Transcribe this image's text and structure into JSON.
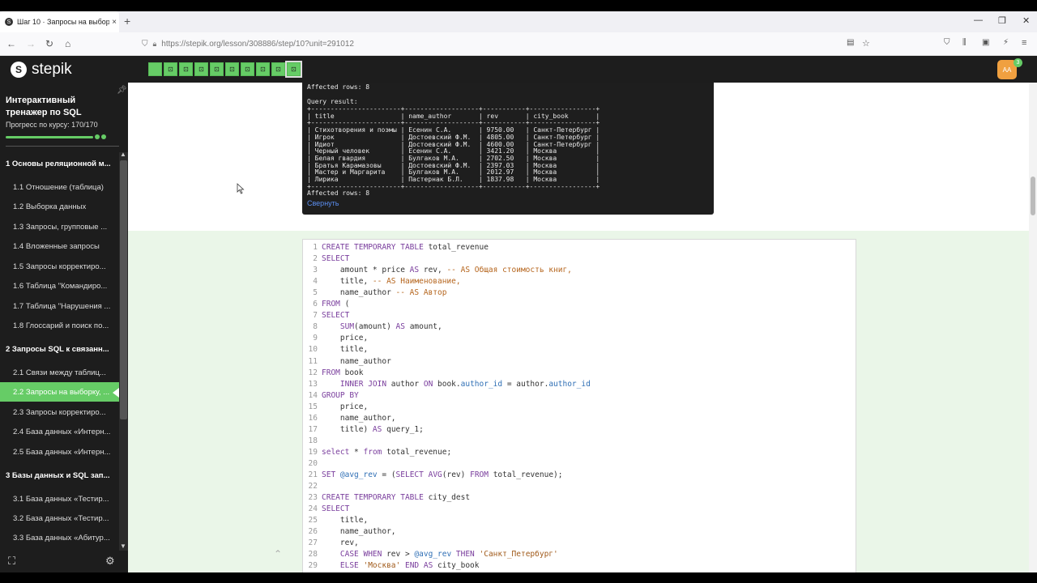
{
  "browser": {
    "tab_title": "Шаг 10 · Запросы на выборку",
    "tab_close": "×",
    "new_tab": "+",
    "url": "https://stepik.org/lesson/308886/step/10?unit=291012",
    "window_minimize": "—",
    "window_restore": "❐",
    "window_close": "✕"
  },
  "app": {
    "logo_text": "stepik",
    "step_count": 10,
    "avatar_text": "AA",
    "notification_count": "3"
  },
  "sidebar": {
    "course_title": "Интерактивный тренажер по SQL",
    "progress_label": "Прогресс по курсу:",
    "progress_value": "170/170",
    "progress_fraction": 1.0,
    "items": [
      {
        "label": "1  Основы реляционной м...",
        "kind": "module"
      },
      {
        "label": "1.1  Отношение (таблица)",
        "kind": "lesson"
      },
      {
        "label": "1.2  Выборка данных",
        "kind": "lesson"
      },
      {
        "label": "1.3  Запросы, групповые ...",
        "kind": "lesson"
      },
      {
        "label": "1.4  Вложенные запросы",
        "kind": "lesson"
      },
      {
        "label": "1.5  Запросы корректиро...",
        "kind": "lesson"
      },
      {
        "label": "1.6  Таблица \"Командиро...",
        "kind": "lesson"
      },
      {
        "label": "1.7  Таблица \"Нарушения ...",
        "kind": "lesson"
      },
      {
        "label": "1.8  Глоссарий и поиск по...",
        "kind": "lesson"
      },
      {
        "label": "2  Запросы SQL к связанн...",
        "kind": "module"
      },
      {
        "label": "2.1  Связи между таблиц...",
        "kind": "lesson"
      },
      {
        "label": "2.2  Запросы на выборку, ...",
        "kind": "lesson",
        "current": true
      },
      {
        "label": "2.3  Запросы корректиро...",
        "kind": "lesson"
      },
      {
        "label": "2.4  База данных «Интерн...",
        "kind": "lesson"
      },
      {
        "label": "2.5  База данных «Интерн...",
        "kind": "lesson"
      },
      {
        "label": "3  Базы данных и SQL зап...",
        "kind": "module"
      },
      {
        "label": "3.1  База данных «Тестир...",
        "kind": "lesson"
      },
      {
        "label": "3.2  База данных «Тестир...",
        "kind": "lesson"
      },
      {
        "label": "3.3  База данных «Абитур...",
        "kind": "lesson"
      }
    ]
  },
  "console": {
    "affected_top": "Affected rows: 8",
    "query_result_label": "Query result:",
    "table_text": "+-----------------------+-------------------+-----------+-----------------+\n| title                 | name_author       | rev       | city_book       |\n+-----------------------+-------------------+-----------+-----------------+\n| Стихотворения и поэмы | Есенин С.А.       | 9750.00   | Санкт-Петербург |\n| Игрок                 | Достоевский Ф.М.  | 4805.00   | Санкт-Петербург |\n| Идиот                 | Достоевский Ф.М.  | 4600.00   | Санкт-Петербург |\n| Черный человек        | Есенин С.А.       | 3421.20   | Москва          |\n| Белая гвардия         | Булгаков М.А.     | 2702.50   | Москва          |\n| Братья Карамазовы     | Достоевский Ф.М.  | 2397.03   | Москва          |\n| Мастер и Маргарита    | Булгаков М.А.     | 2012.97   | Москва          |\n| Лирика                | Пастернак Б.Л.    | 1837.98   | Москва          |\n+-----------------------+-------------------+-----------+-----------------+",
    "affected_bottom": "Affected rows: 8",
    "collapse_label": "Свернуть"
  },
  "code_lines": [
    [
      [
        "kw",
        "CREATE TEMPORARY TABLE "
      ],
      [
        "id",
        "total_revenue"
      ]
    ],
    [
      [
        "kw",
        "SELECT"
      ]
    ],
    [
      [
        "id",
        "    amount * price "
      ],
      [
        "kw",
        "AS"
      ],
      [
        "id",
        " rev, "
      ],
      [
        "cm",
        "-- AS Общая стоимость книг,"
      ]
    ],
    [
      [
        "id",
        "    title, "
      ],
      [
        "cm",
        "-- AS Наименование,"
      ]
    ],
    [
      [
        "id",
        "    name_author "
      ],
      [
        "cm",
        "-- AS Автор"
      ]
    ],
    [
      [
        "kw",
        "FROM"
      ],
      [
        "id",
        " ("
      ]
    ],
    [
      [
        "kw",
        "SELECT"
      ]
    ],
    [
      [
        "fn",
        "    SUM"
      ],
      [
        "id",
        "(amount) "
      ],
      [
        "kw",
        "AS"
      ],
      [
        "id",
        " amount,"
      ]
    ],
    [
      [
        "id",
        "    price,"
      ]
    ],
    [
      [
        "id",
        "    title,"
      ]
    ],
    [
      [
        "id",
        "    name_author"
      ]
    ],
    [
      [
        "kw",
        "FROM"
      ],
      [
        "id",
        " book"
      ]
    ],
    [
      [
        "kw",
        "    INNER JOIN"
      ],
      [
        "id",
        " author "
      ],
      [
        "kw",
        "ON"
      ],
      [
        "id",
        " book."
      ],
      [
        "var",
        "author_id"
      ],
      [
        "id",
        " = author."
      ],
      [
        "var",
        "author_id"
      ]
    ],
    [
      [
        "kw",
        "GROUP BY"
      ]
    ],
    [
      [
        "id",
        "    price,"
      ]
    ],
    [
      [
        "id",
        "    name_author,"
      ]
    ],
    [
      [
        "id",
        "    title) "
      ],
      [
        "kw",
        "AS"
      ],
      [
        "id",
        " query_1;"
      ]
    ],
    [
      [
        "id",
        ""
      ]
    ],
    [
      [
        "kw",
        "select"
      ],
      [
        "id",
        " * "
      ],
      [
        "kw",
        "from"
      ],
      [
        "id",
        " total_revenue;"
      ]
    ],
    [
      [
        "id",
        ""
      ]
    ],
    [
      [
        "kw",
        "SET "
      ],
      [
        "var",
        "@avg_rev"
      ],
      [
        "id",
        " = ("
      ],
      [
        "kw",
        "SELECT "
      ],
      [
        "fn",
        "AVG"
      ],
      [
        "id",
        "(rev) "
      ],
      [
        "kw",
        "FROM"
      ],
      [
        "id",
        " total_revenue);"
      ]
    ],
    [
      [
        "id",
        ""
      ]
    ],
    [
      [
        "kw",
        "CREATE TEMPORARY TABLE "
      ],
      [
        "id",
        "city_dest"
      ]
    ],
    [
      [
        "kw",
        "SELECT"
      ]
    ],
    [
      [
        "id",
        "    title,"
      ]
    ],
    [
      [
        "id",
        "    name_author,"
      ]
    ],
    [
      [
        "id",
        "    rev,"
      ]
    ],
    [
      [
        "kw",
        "    CASE WHEN"
      ],
      [
        "id",
        " rev > "
      ],
      [
        "var",
        "@avg_rev"
      ],
      [
        "kw",
        " THEN "
      ],
      [
        "str",
        "'Санкт_Петербург'"
      ]
    ],
    [
      [
        "kw",
        "    ELSE "
      ],
      [
        "str",
        "'Москва'"
      ],
      [
        "kw",
        " END AS"
      ],
      [
        "id",
        " city_book"
      ]
    ]
  ]
}
